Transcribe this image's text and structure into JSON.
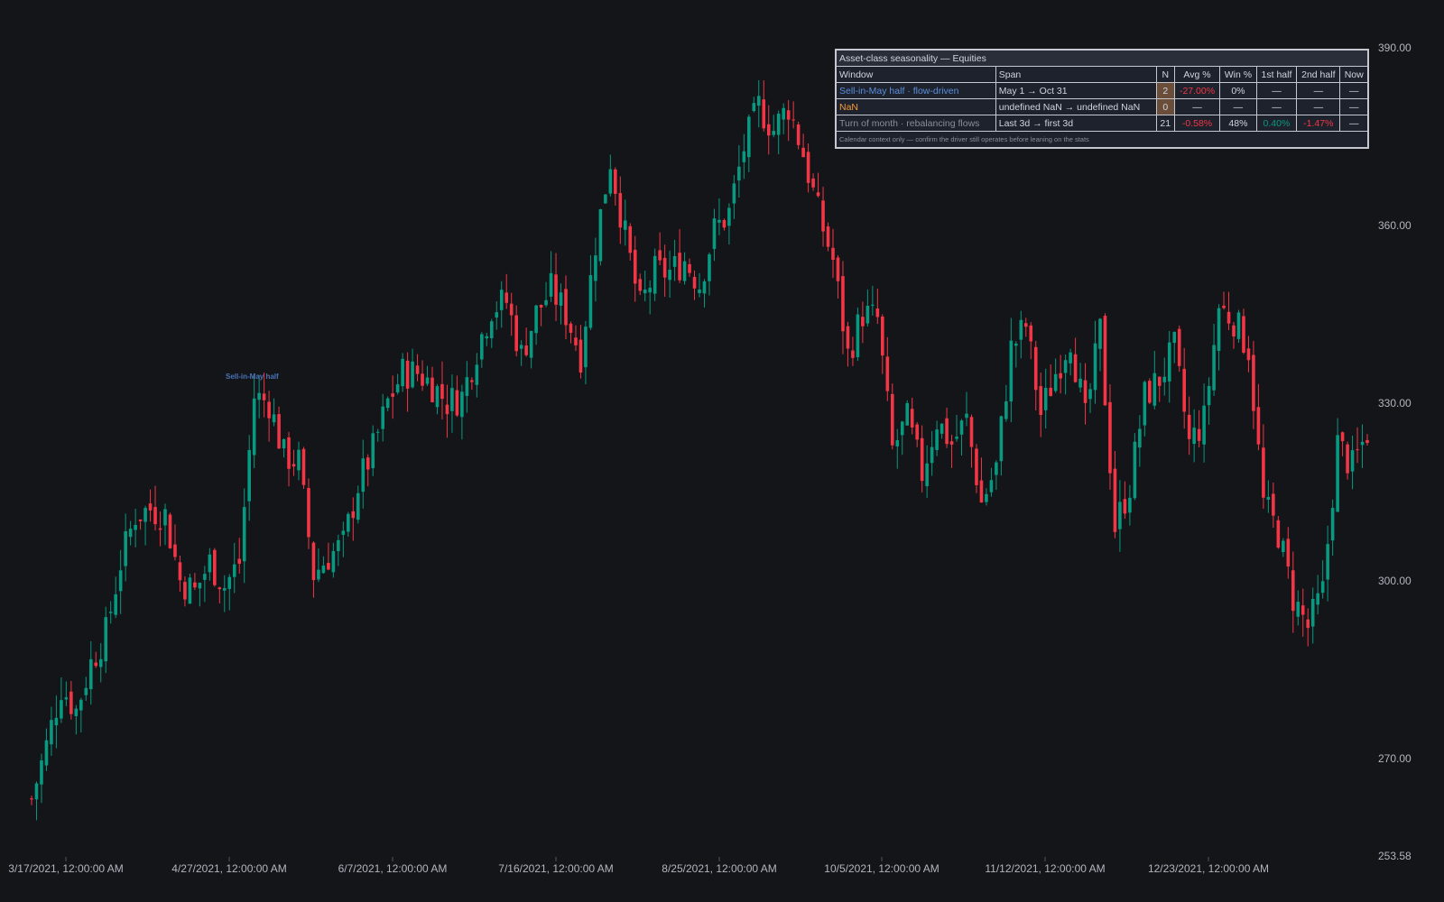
{
  "colors": {
    "background": "#141519",
    "up": "#089981",
    "down": "#f23645",
    "axis_text": "#b2b5be",
    "accent_blue": "#5b8fdd",
    "accent_orange": "#f59a3a"
  },
  "annotation": {
    "label": "Sell-in-May half"
  },
  "seasonality_table": {
    "title": "Asset-class seasonality — Equities",
    "headers": [
      "Window",
      "Span",
      "N",
      "Avg %",
      "Win %",
      "1st half",
      "2nd half",
      "Now"
    ],
    "rows": [
      {
        "window": "Sell-in-May half · flow-driven",
        "span": "May 1 → Oct 31",
        "n": "2",
        "avg": "-27.00%",
        "win": "0%",
        "first_half": "—",
        "second_half": "—",
        "now": "—"
      },
      {
        "window": "NaN",
        "span": "undefined NaN → undefined NaN",
        "n": "0",
        "avg": "—",
        "win": "—",
        "first_half": "—",
        "second_half": "—",
        "now": "—"
      },
      {
        "window": "Turn of month · rebalancing flows",
        "span": "Last 3d → first 3d",
        "n": "21",
        "avg": "-0.58%",
        "win": "48%",
        "first_half": "0.40%",
        "second_half": "-1.47%",
        "now": "—"
      }
    ],
    "footer": "Calendar context only — confirm the driver still operates before leaning on the stats"
  },
  "chart_data": {
    "type": "candlestick",
    "price_labels": [
      "390.00",
      "360.00",
      "330.00",
      "300.00",
      "270.00",
      "253.58"
    ],
    "date_labels": [
      "3/17/2021, 12:00:00 AM",
      "4/27/2021, 12:00:00 AM",
      "6/7/2021, 12:00:00 AM",
      "7/16/2021, 12:00:00 AM",
      "8/25/2021, 12:00:00 AM",
      "10/5/2021, 12:00:00 AM",
      "11/12/2021, 12:00:00 AM",
      "12/23/2021, 12:00:00 AM"
    ],
    "y_range": [
      253.58,
      395
    ],
    "grid": false,
    "close_path": [
      [
        0,
        263
      ],
      [
        3,
        272
      ],
      [
        6,
        282
      ],
      [
        9,
        278
      ],
      [
        12,
        286
      ],
      [
        15,
        291
      ],
      [
        18,
        303
      ],
      [
        21,
        311
      ],
      [
        24,
        312
      ],
      [
        27,
        311
      ],
      [
        30,
        300
      ],
      [
        33,
        298
      ],
      [
        36,
        303
      ],
      [
        39,
        299
      ],
      [
        42,
        303
      ],
      [
        45,
        331
      ],
      [
        48,
        330
      ],
      [
        51,
        321
      ],
      [
        54,
        320
      ],
      [
        57,
        301
      ],
      [
        60,
        304
      ],
      [
        63,
        306
      ],
      [
        66,
        316
      ],
      [
        69,
        322
      ],
      [
        72,
        330
      ],
      [
        75,
        335
      ],
      [
        78,
        335
      ],
      [
        81,
        333
      ],
      [
        84,
        330
      ],
      [
        87,
        331
      ],
      [
        90,
        339
      ],
      [
        93,
        346
      ],
      [
        96,
        347
      ],
      [
        99,
        338
      ],
      [
        102,
        345
      ],
      [
        105,
        349
      ],
      [
        108,
        345
      ],
      [
        111,
        338
      ],
      [
        114,
        357
      ],
      [
        117,
        371
      ],
      [
        120,
        358
      ],
      [
        123,
        346
      ],
      [
        126,
        352
      ],
      [
        129,
        352
      ],
      [
        132,
        354
      ],
      [
        135,
        350
      ],
      [
        138,
        359
      ],
      [
        141,
        362
      ],
      [
        144,
        373
      ],
      [
        147,
        380
      ],
      [
        150,
        376
      ],
      [
        153,
        380
      ],
      [
        156,
        372
      ],
      [
        159,
        362
      ],
      [
        162,
        354
      ],
      [
        165,
        338
      ],
      [
        168,
        345
      ],
      [
        171,
        344
      ],
      [
        174,
        322
      ],
      [
        177,
        327
      ],
      [
        180,
        318
      ],
      [
        183,
        327
      ],
      [
        186,
        323
      ],
      [
        189,
        327
      ],
      [
        192,
        313
      ],
      [
        195,
        319
      ],
      [
        198,
        339
      ],
      [
        201,
        343
      ],
      [
        204,
        328
      ],
      [
        207,
        335
      ],
      [
        210,
        341
      ],
      [
        213,
        327
      ],
      [
        216,
        342
      ],
      [
        219,
        309
      ],
      [
        222,
        316
      ],
      [
        225,
        331
      ],
      [
        228,
        334
      ],
      [
        231,
        339
      ],
      [
        234,
        323
      ],
      [
        237,
        327
      ],
      [
        240,
        346
      ],
      [
        243,
        344
      ],
      [
        246,
        339
      ],
      [
        249,
        313
      ],
      [
        252,
        308
      ],
      [
        255,
        297
      ],
      [
        258,
        292
      ],
      [
        261,
        298
      ],
      [
        264,
        323
      ],
      [
        267,
        319
      ],
      [
        270,
        325
      ]
    ],
    "up_color": "#089981",
    "down_color": "#f23645"
  }
}
